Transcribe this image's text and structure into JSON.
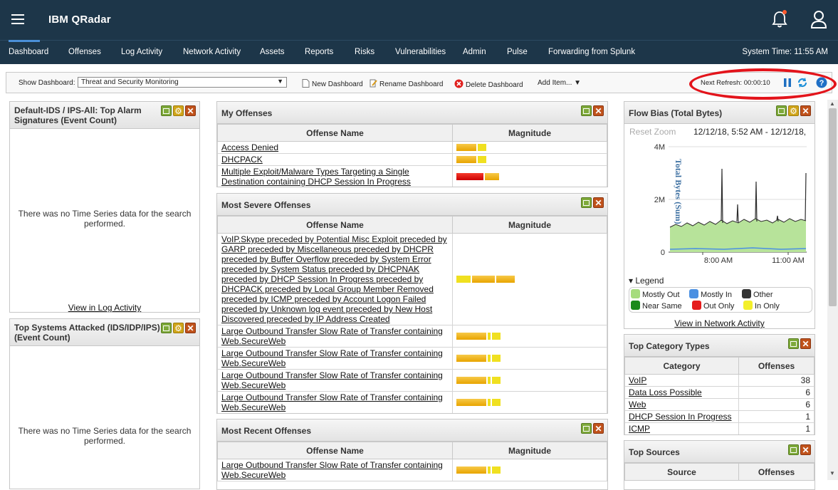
{
  "app": {
    "title": "IBM QRadar",
    "system_time": "System Time: 11:55 AM"
  },
  "nav": {
    "tabs": [
      "Dashboard",
      "Offenses",
      "Log Activity",
      "Network Activity",
      "Assets",
      "Reports",
      "Risks",
      "Vulnerabilities",
      "Admin",
      "Pulse",
      "Forwarding from Splunk"
    ]
  },
  "toolbar": {
    "show_label": "Show Dashboard:",
    "dashboard_value": "Threat and Security Monitoring",
    "new_dashboard": "New Dashboard",
    "rename_dashboard": "Rename Dashboard",
    "delete_dashboard": "Delete Dashboard",
    "add_item": "Add Item...",
    "next_refresh": "Next Refresh: 00:00:10"
  },
  "panels": {
    "alarm": {
      "title1": "Default-IDS / IPS-All: Top Alarm",
      "title2": "Signatures (Event Count)",
      "nodata1": "There was no Time Series data for the search",
      "nodata2": "performed.",
      "link": "View in Log Activity"
    },
    "attacked": {
      "title1": "Top Systems Attacked (IDS/IDP/IPS)",
      "title2": "(Event Count)",
      "nodata1": "There was no Time Series data for the search",
      "nodata2": "performed."
    },
    "my_offenses": {
      "title": "My Offenses",
      "col_name": "Offense Name",
      "col_mag": "Magnitude",
      "rows": [
        {
          "name": "Access Denied",
          "mag": "low"
        },
        {
          "name": "DHCPACK",
          "mag": "low"
        },
        {
          "name": "Multiple Exploit/Malware Types Targeting a Single Destination containing DHCP Session In Progress",
          "mag": "high"
        }
      ]
    },
    "severe": {
      "title": "Most Severe Offenses",
      "col_name": "Offense Name",
      "col_mag": "Magnitude",
      "rows": [
        {
          "name": "VoIP.Skype preceded by Potential Misc Exploit preceded by GARP preceded by Miscellaneous preceded by DHCPR preceded by Buffer Overflow preceded by System Error preceded by System Status preceded by DHCPNAK preceded by DHCP Session In Progress preceded by DHCPACK preceded by Local Group Member Removed preceded by ICMP preceded by Account Logon Failed preceded by Unknown log event preceded by New Host Discovered preceded by IP Address Created",
          "mag": "wide"
        },
        {
          "name": "Large Outbound Transfer Slow Rate of Transfer containing Web.SecureWeb",
          "mag": "mid"
        },
        {
          "name": "Large Outbound Transfer Slow Rate of Transfer containing Web.SecureWeb",
          "mag": "mid"
        },
        {
          "name": "Large Outbound Transfer Slow Rate of Transfer containing Web.SecureWeb",
          "mag": "mid"
        },
        {
          "name": "Large Outbound Transfer Slow Rate of Transfer containing Web.SecureWeb",
          "mag": "mid"
        }
      ]
    },
    "recent": {
      "title": "Most Recent Offenses",
      "col_name": "Offense Name",
      "col_mag": "Magnitude",
      "rows": [
        {
          "name": "Large Outbound Transfer Slow Rate of Transfer containing Web.SecureWeb",
          "mag": "mid"
        }
      ]
    },
    "flow": {
      "title": "Flow Bias (Total Bytes)",
      "reset_zoom": "Reset Zoom",
      "range": "12/12/18, 5:52 AM - 12/12/18,",
      "ylabel": "Total Bytes (Sum)",
      "yticks": [
        "4M",
        "2M",
        "0"
      ],
      "xticks": [
        "8:00 AM",
        "11:00 AM"
      ],
      "legend_title": "Legend",
      "legend": [
        {
          "label": "Mostly Out",
          "color": "#a6dc7d"
        },
        {
          "label": "Mostly In",
          "color": "#4a90e2"
        },
        {
          "label": "Other",
          "color": "#333333"
        },
        {
          "label": "Near Same",
          "color": "#1b8a1b"
        },
        {
          "label": "Out Only",
          "color": "#e51c1c"
        },
        {
          "label": "In Only",
          "color": "#f3ef2a"
        }
      ],
      "link": "View in Network Activity"
    },
    "category": {
      "title": "Top Category Types",
      "col_cat": "Category",
      "col_off": "Offenses",
      "rows": [
        {
          "name": "VoIP",
          "count": "38"
        },
        {
          "name": "Data Loss Possible",
          "count": "6"
        },
        {
          "name": "Web",
          "count": "6"
        },
        {
          "name": "DHCP Session In Progress",
          "count": "1"
        },
        {
          "name": "ICMP",
          "count": "1"
        }
      ]
    },
    "sources": {
      "title": "Top Sources",
      "col_src": "Source",
      "col_off": "Offenses"
    }
  }
}
